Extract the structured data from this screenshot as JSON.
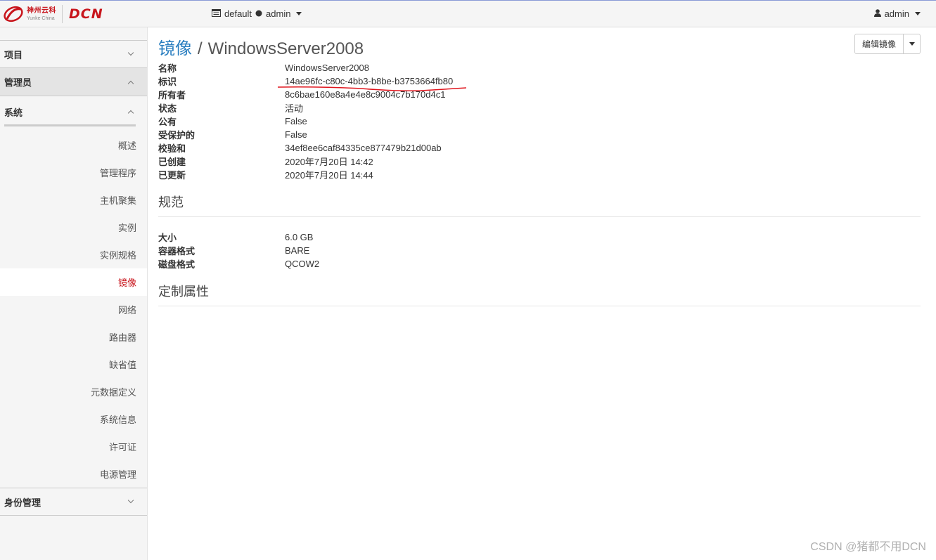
{
  "topbar": {
    "logo_cn": "神州云科",
    "logo_en": "Yunke China",
    "logo_dcn": "DCN",
    "project_domain": "default",
    "project_name": "admin",
    "user": "admin"
  },
  "sidebar": {
    "sections": {
      "project": "项目",
      "admin": "管理员",
      "system": "系统",
      "identity": "身份管理"
    },
    "items": [
      {
        "label": "概述"
      },
      {
        "label": "管理程序"
      },
      {
        "label": "主机聚集"
      },
      {
        "label": "实例"
      },
      {
        "label": "实例规格"
      },
      {
        "label": "镜像"
      },
      {
        "label": "网络"
      },
      {
        "label": "路由器"
      },
      {
        "label": "缺省值"
      },
      {
        "label": "元数据定义"
      },
      {
        "label": "系统信息"
      },
      {
        "label": "许可证"
      },
      {
        "label": "电源管理"
      }
    ],
    "active_color": "#c8151c"
  },
  "main": {
    "breadcrumb": "镜像",
    "title": "WindowsServer2008",
    "edit_button": "编辑镜像",
    "overview": [
      {
        "key": "名称",
        "value": "WindowsServer2008"
      },
      {
        "key": "标识",
        "value": "14ae96fc-c80c-4bb3-b8be-b3753664fb80"
      },
      {
        "key": "所有者",
        "value": "8c6bae160e8a4e4e8c9004c7b170d4c1"
      },
      {
        "key": "状态",
        "value": "活动"
      },
      {
        "key": "公有",
        "value": "False"
      },
      {
        "key": "受保护的",
        "value": "False"
      },
      {
        "key": "校验和",
        "value": "34ef8ee6caf84335ce877479b21d00ab"
      },
      {
        "key": "已创建",
        "value": "2020年7月20日 14:42"
      },
      {
        "key": "已更新",
        "value": "2020年7月20日 14:44"
      }
    ],
    "specs_title": "规范",
    "specs": [
      {
        "key": "大小",
        "value": "6.0 GB"
      },
      {
        "key": "容器格式",
        "value": "BARE"
      },
      {
        "key": "磁盘格式",
        "value": "QCOW2"
      }
    ],
    "custom_title": "定制属性"
  },
  "watermark": "CSDN @猪都不用DCN",
  "colors": {
    "link": "#2b7fc0",
    "brand": "#c8151c",
    "annotation": "#e0141c"
  }
}
